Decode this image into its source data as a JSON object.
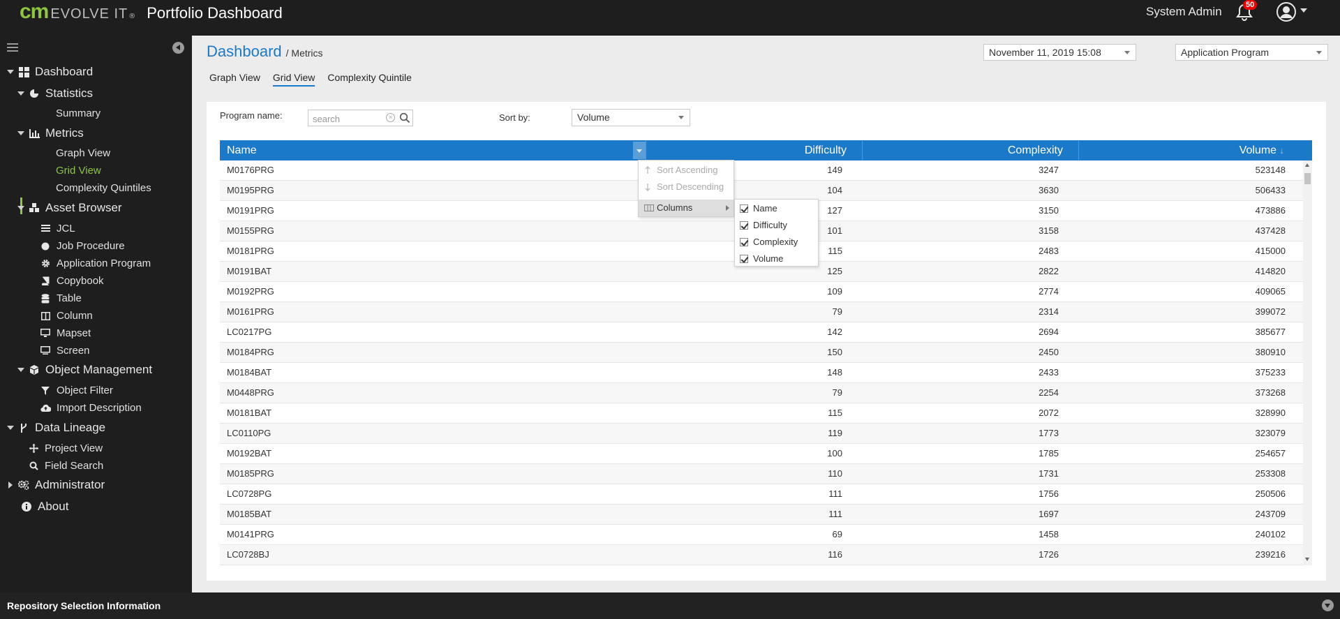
{
  "header": {
    "brand_cm": "CM",
    "brand_evolve": "EVOLVE IT",
    "brand_reg": "®",
    "app_title": "Portfolio Dashboard",
    "user_name": "System Admin",
    "notification_count": "50"
  },
  "sidebar": {
    "dashboard": "Dashboard",
    "statistics": "Statistics",
    "summary": "Summary",
    "metrics": "Metrics",
    "graph_view": "Graph View",
    "grid_view": "Grid View",
    "complexity_quintiles": "Complexity Quintiles",
    "asset_browser": "Asset Browser",
    "jcl": "JCL",
    "job_procedure": "Job Procedure",
    "application_program": "Application Program",
    "copybook": "Copybook",
    "table": "Table",
    "column": "Column",
    "mapset": "Mapset",
    "screen": "Screen",
    "object_management": "Object Management",
    "object_filter": "Object Filter",
    "import_description": "Import Description",
    "data_lineage": "Data Lineage",
    "project_view": "Project View",
    "field_search": "Field Search",
    "administrator": "Administrator",
    "about": "About"
  },
  "main": {
    "breadcrumb_root": "Dashboard",
    "breadcrumb_current": "/ Metrics",
    "date_select": "November 11, 2019 15:08",
    "type_select": "Application Program",
    "tabs": [
      "Graph View",
      "Grid View",
      "Complexity Quintile"
    ],
    "program_name_label": "Program name:",
    "search_placeholder": "search",
    "sort_by_label": "Sort by:",
    "sort_by_value": "Volume"
  },
  "grid": {
    "columns": [
      "Name",
      "Difficulty",
      "Complexity",
      "Volume"
    ],
    "sort_indicator": "↓",
    "rows": [
      [
        "M0176PRG",
        "149",
        "3247",
        "523148"
      ],
      [
        "M0195PRG",
        "104",
        "3630",
        "506433"
      ],
      [
        "M0191PRG",
        "127",
        "3150",
        "473886"
      ],
      [
        "M0155PRG",
        "101",
        "3158",
        "437428"
      ],
      [
        "M0181PRG",
        "115",
        "2483",
        "415000"
      ],
      [
        "M0191BAT",
        "125",
        "2822",
        "414820"
      ],
      [
        "M0192PRG",
        "109",
        "2774",
        "409065"
      ],
      [
        "M0161PRG",
        "79",
        "2314",
        "399072"
      ],
      [
        "LC0217PG",
        "142",
        "2694",
        "385677"
      ],
      [
        "M0184PRG",
        "150",
        "2450",
        "380910"
      ],
      [
        "M0184BAT",
        "148",
        "2433",
        "375233"
      ],
      [
        "M0448PRG",
        "79",
        "2254",
        "373268"
      ],
      [
        "M0181BAT",
        "115",
        "2072",
        "328990"
      ],
      [
        "LC0110PG",
        "119",
        "1773",
        "323079"
      ],
      [
        "M0192BAT",
        "100",
        "1785",
        "254657"
      ],
      [
        "M0185PRG",
        "110",
        "1731",
        "253308"
      ],
      [
        "LC0728PG",
        "111",
        "1756",
        "250506"
      ],
      [
        "M0185BAT",
        "111",
        "1697",
        "243709"
      ],
      [
        "M0141PRG",
        "69",
        "1458",
        "240102"
      ],
      [
        "LC0728BJ",
        "116",
        "1726",
        "239216"
      ]
    ]
  },
  "column_menu": {
    "sort_ascending": "Sort Ascending",
    "sort_descending": "Sort Descending",
    "columns": "Columns",
    "column_options": [
      "Name",
      "Difficulty",
      "Complexity",
      "Volume"
    ]
  },
  "footer": {
    "label": "Repository Selection Information"
  }
}
